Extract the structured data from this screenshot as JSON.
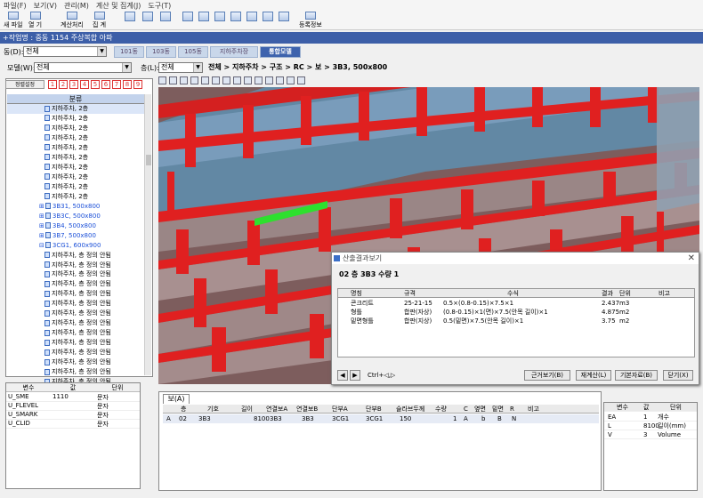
{
  "menu": [
    "파일(F)",
    "보기(V)",
    "관리(M)",
    "계산 및 집계(J)",
    "도구(T)"
  ],
  "toolbar": {
    "new_file": "새 파일",
    "open": "열   기",
    "calc": "계산처리",
    "total": "집   계",
    "reg_info": "등록정보"
  },
  "title": "+작업명 : 중동 1154 주상복합 아파",
  "building": {
    "label": "동(D):",
    "value": "전체"
  },
  "tabs": [
    "101동",
    "103동",
    "105동",
    "지하주차장",
    "통합모델"
  ],
  "model": {
    "label": "모델(W):",
    "value": "전체"
  },
  "floor": {
    "label": "층(L):",
    "value": "전체"
  },
  "path": "전체 > 지하주차 > 구조 > RC > 보 > 3B3, 500x800",
  "left": {
    "view_btn": "정렬설정",
    "numbers": [
      "1",
      "2",
      "3",
      "4",
      "5",
      "6",
      "7",
      "8",
      "9"
    ],
    "tree_header": "분류",
    "items": [
      {
        "label": "지하주차, 2층",
        "type": "leaf",
        "selected": true
      },
      {
        "label": "지하주차, 2층",
        "type": "leaf"
      },
      {
        "label": "지하주차, 2층",
        "type": "leaf"
      },
      {
        "label": "지하주차, 2층",
        "type": "leaf"
      },
      {
        "label": "지하주차, 2층",
        "type": "leaf"
      },
      {
        "label": "지하주차, 2층",
        "type": "leaf"
      },
      {
        "label": "지하주차, 2층",
        "type": "leaf"
      },
      {
        "label": "지하주차, 2층",
        "type": "leaf"
      },
      {
        "label": "지하주차, 2층",
        "type": "leaf"
      },
      {
        "label": "지하주차, 2층",
        "type": "leaf"
      },
      {
        "label": "3B31, 500x800",
        "type": "group"
      },
      {
        "label": "3B3C, 500x800",
        "type": "group"
      },
      {
        "label": "3B4, 500x800",
        "type": "group"
      },
      {
        "label": "3B7, 500x800",
        "type": "group"
      },
      {
        "label": "3CG1, 600x900",
        "type": "group-open"
      },
      {
        "label": "지하주차, 층 정의 안됨",
        "type": "leaf"
      },
      {
        "label": "지하주차, 층 정의 안됨",
        "type": "leaf"
      },
      {
        "label": "지하주차, 층 정의 안됨",
        "type": "leaf"
      },
      {
        "label": "지하주차, 층 정의 안됨",
        "type": "leaf"
      },
      {
        "label": "지하주차, 층 정의 안됨",
        "type": "leaf"
      },
      {
        "label": "지하주차, 층 정의 안됨",
        "type": "leaf"
      },
      {
        "label": "지하주차, 층 정의 안됨",
        "type": "leaf"
      },
      {
        "label": "지하주차, 층 정의 안됨",
        "type": "leaf"
      },
      {
        "label": "지하주차, 층 정의 안됨",
        "type": "leaf"
      },
      {
        "label": "지하주차, 층 정의 안됨",
        "type": "leaf"
      },
      {
        "label": "지하주차, 층 정의 안됨",
        "type": "leaf"
      },
      {
        "label": "지하주차, 층 정의 안됨",
        "type": "leaf"
      },
      {
        "label": "지하주차, 층 정의 안됨",
        "type": "leaf"
      },
      {
        "label": "지하주차, 층 정의 안됨",
        "type": "leaf"
      },
      {
        "label": "지하주차, 층 정의 안됨",
        "type": "leaf"
      }
    ]
  },
  "props": {
    "headers": [
      "변수",
      "값",
      "단위"
    ],
    "rows": [
      [
        "U_SME",
        "1110",
        "문자"
      ],
      [
        "U_FLEVEL",
        "",
        "문자"
      ],
      [
        "U_SMARK",
        "",
        "문자"
      ],
      [
        "U_CLID",
        "",
        "문자"
      ]
    ]
  },
  "dialog": {
    "title": "산출결과보기",
    "heading": "02 층  3B3  수량 1",
    "headers": [
      "명칭",
      "규격",
      "수식",
      "결과",
      "단위",
      "비고"
    ],
    "rows": [
      [
        "콘크리트",
        "25-21-15",
        "0.5×(0.8-0.15)×7.5×1",
        "2.437",
        "m3",
        ""
      ],
      [
        "형틀",
        "합판(자상)",
        "(0.8-0.15)×1(면)×7.5(안목 길이)×1",
        "4.875",
        "m2",
        ""
      ],
      [
        "밑면형틀",
        "합판(지상)",
        "0.5(밑면)×7.5(안목 길이)×1",
        "3.75",
        "m2",
        ""
      ]
    ],
    "shortcut": "Ctrl+◁,▷",
    "buttons": [
      "근거보기(B)",
      "재계산(L)",
      "기본자료(B)",
      "닫기(X)"
    ]
  },
  "bottom": {
    "tab": "보(A)",
    "headers": [
      "층",
      "기호",
      "길이",
      "연결보A",
      "연결보B",
      "단부A",
      "단부B",
      "슬라브두께",
      "수량",
      "C",
      "옆면",
      "밑면",
      "R",
      "비고"
    ],
    "row_letter": "A",
    "row": [
      "02",
      "3B3",
      "8100",
      "3B3",
      "3B3",
      "3CG1",
      "3CG1",
      "150",
      "1",
      "A",
      "b",
      "B",
      "N",
      ""
    ]
  },
  "right": {
    "headers": [
      "변수",
      "값",
      "단위"
    ],
    "rows": [
      [
        "EA",
        "1",
        "개수"
      ],
      [
        "L",
        "8100",
        "길이(mm)"
      ],
      [
        "V",
        "3",
        "Volume"
      ]
    ]
  }
}
